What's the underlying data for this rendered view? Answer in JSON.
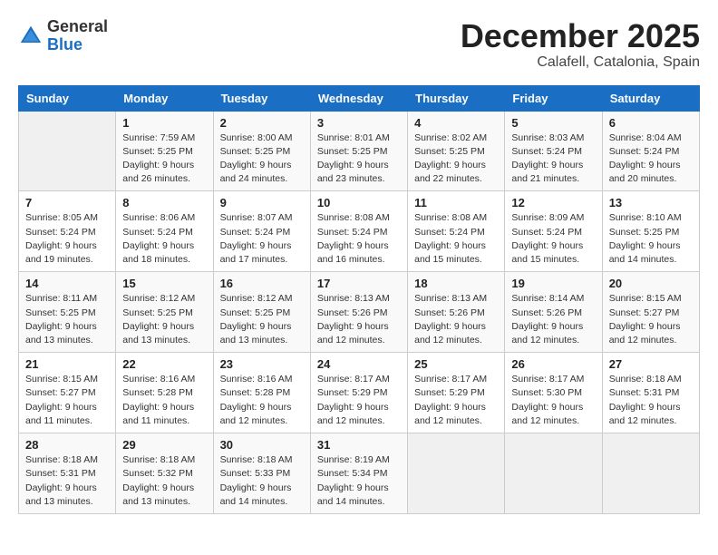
{
  "header": {
    "logo_general": "General",
    "logo_blue": "Blue",
    "month": "December 2025",
    "location": "Calafell, Catalonia, Spain"
  },
  "days_of_week": [
    "Sunday",
    "Monday",
    "Tuesday",
    "Wednesday",
    "Thursday",
    "Friday",
    "Saturday"
  ],
  "weeks": [
    [
      {
        "day": "",
        "info": ""
      },
      {
        "day": "1",
        "info": "Sunrise: 7:59 AM\nSunset: 5:25 PM\nDaylight: 9 hours\nand 26 minutes."
      },
      {
        "day": "2",
        "info": "Sunrise: 8:00 AM\nSunset: 5:25 PM\nDaylight: 9 hours\nand 24 minutes."
      },
      {
        "day": "3",
        "info": "Sunrise: 8:01 AM\nSunset: 5:25 PM\nDaylight: 9 hours\nand 23 minutes."
      },
      {
        "day": "4",
        "info": "Sunrise: 8:02 AM\nSunset: 5:25 PM\nDaylight: 9 hours\nand 22 minutes."
      },
      {
        "day": "5",
        "info": "Sunrise: 8:03 AM\nSunset: 5:24 PM\nDaylight: 9 hours\nand 21 minutes."
      },
      {
        "day": "6",
        "info": "Sunrise: 8:04 AM\nSunset: 5:24 PM\nDaylight: 9 hours\nand 20 minutes."
      }
    ],
    [
      {
        "day": "7",
        "info": "Sunrise: 8:05 AM\nSunset: 5:24 PM\nDaylight: 9 hours\nand 19 minutes."
      },
      {
        "day": "8",
        "info": "Sunrise: 8:06 AM\nSunset: 5:24 PM\nDaylight: 9 hours\nand 18 minutes."
      },
      {
        "day": "9",
        "info": "Sunrise: 8:07 AM\nSunset: 5:24 PM\nDaylight: 9 hours\nand 17 minutes."
      },
      {
        "day": "10",
        "info": "Sunrise: 8:08 AM\nSunset: 5:24 PM\nDaylight: 9 hours\nand 16 minutes."
      },
      {
        "day": "11",
        "info": "Sunrise: 8:08 AM\nSunset: 5:24 PM\nDaylight: 9 hours\nand 15 minutes."
      },
      {
        "day": "12",
        "info": "Sunrise: 8:09 AM\nSunset: 5:24 PM\nDaylight: 9 hours\nand 15 minutes."
      },
      {
        "day": "13",
        "info": "Sunrise: 8:10 AM\nSunset: 5:25 PM\nDaylight: 9 hours\nand 14 minutes."
      }
    ],
    [
      {
        "day": "14",
        "info": "Sunrise: 8:11 AM\nSunset: 5:25 PM\nDaylight: 9 hours\nand 13 minutes."
      },
      {
        "day": "15",
        "info": "Sunrise: 8:12 AM\nSunset: 5:25 PM\nDaylight: 9 hours\nand 13 minutes."
      },
      {
        "day": "16",
        "info": "Sunrise: 8:12 AM\nSunset: 5:25 PM\nDaylight: 9 hours\nand 13 minutes."
      },
      {
        "day": "17",
        "info": "Sunrise: 8:13 AM\nSunset: 5:26 PM\nDaylight: 9 hours\nand 12 minutes."
      },
      {
        "day": "18",
        "info": "Sunrise: 8:13 AM\nSunset: 5:26 PM\nDaylight: 9 hours\nand 12 minutes."
      },
      {
        "day": "19",
        "info": "Sunrise: 8:14 AM\nSunset: 5:26 PM\nDaylight: 9 hours\nand 12 minutes."
      },
      {
        "day": "20",
        "info": "Sunrise: 8:15 AM\nSunset: 5:27 PM\nDaylight: 9 hours\nand 12 minutes."
      }
    ],
    [
      {
        "day": "21",
        "info": "Sunrise: 8:15 AM\nSunset: 5:27 PM\nDaylight: 9 hours\nand 11 minutes."
      },
      {
        "day": "22",
        "info": "Sunrise: 8:16 AM\nSunset: 5:28 PM\nDaylight: 9 hours\nand 11 minutes."
      },
      {
        "day": "23",
        "info": "Sunrise: 8:16 AM\nSunset: 5:28 PM\nDaylight: 9 hours\nand 12 minutes."
      },
      {
        "day": "24",
        "info": "Sunrise: 8:17 AM\nSunset: 5:29 PM\nDaylight: 9 hours\nand 12 minutes."
      },
      {
        "day": "25",
        "info": "Sunrise: 8:17 AM\nSunset: 5:29 PM\nDaylight: 9 hours\nand 12 minutes."
      },
      {
        "day": "26",
        "info": "Sunrise: 8:17 AM\nSunset: 5:30 PM\nDaylight: 9 hours\nand 12 minutes."
      },
      {
        "day": "27",
        "info": "Sunrise: 8:18 AM\nSunset: 5:31 PM\nDaylight: 9 hours\nand 12 minutes."
      }
    ],
    [
      {
        "day": "28",
        "info": "Sunrise: 8:18 AM\nSunset: 5:31 PM\nDaylight: 9 hours\nand 13 minutes."
      },
      {
        "day": "29",
        "info": "Sunrise: 8:18 AM\nSunset: 5:32 PM\nDaylight: 9 hours\nand 13 minutes."
      },
      {
        "day": "30",
        "info": "Sunrise: 8:18 AM\nSunset: 5:33 PM\nDaylight: 9 hours\nand 14 minutes."
      },
      {
        "day": "31",
        "info": "Sunrise: 8:19 AM\nSunset: 5:34 PM\nDaylight: 9 hours\nand 14 minutes."
      },
      {
        "day": "",
        "info": ""
      },
      {
        "day": "",
        "info": ""
      },
      {
        "day": "",
        "info": ""
      }
    ]
  ]
}
